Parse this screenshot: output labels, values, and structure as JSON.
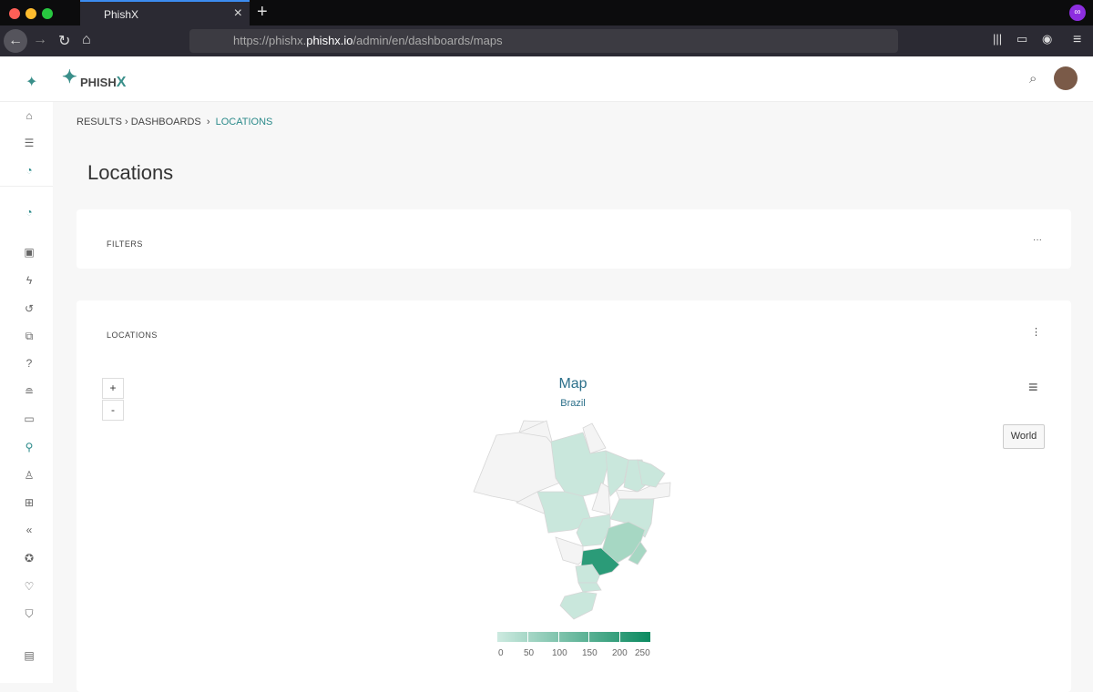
{
  "browser": {
    "tab_title": "PhishX",
    "url_prefix": "https://phishx.",
    "url_domain": "phishx.io",
    "url_path": "/admin/en/dashboards/maps"
  },
  "app": {
    "logo_text": "PHISH",
    "logo_x": "X"
  },
  "sidebar": {
    "icons": [
      "home-icon",
      "list-icon",
      "chart-pie-icon",
      "chart-pie-icon",
      "image-icon",
      "bolt-icon",
      "history-icon",
      "campaign-icon",
      "question-icon",
      "database-icon",
      "monitor-icon",
      "location-pin-icon",
      "user-icon",
      "presentation-icon",
      "rewind-icon",
      "award-icon",
      "heartbeat-icon",
      "shield-icon",
      "file-icon"
    ]
  },
  "breadcrumb": {
    "items": [
      "RESULTS",
      "DASHBOARDS"
    ],
    "current": "LOCATIONS"
  },
  "page": {
    "title": "Locations"
  },
  "filters": {
    "title": "FILTERS",
    "menu": "···"
  },
  "locations_card": {
    "title": "LOCATIONS",
    "menu": "⋮",
    "map": {
      "title": "Map",
      "subtitle": "Brazil",
      "zoom_in": "+",
      "zoom_out": "-",
      "world_button": "World",
      "menu": "≡",
      "legend_ticks": [
        "0",
        "50",
        "100",
        "150",
        "200",
        "250"
      ],
      "colors": {
        "none": "#f4f4f4",
        "low": "#c9e7dc",
        "mid": "#a6d7c3",
        "high": "#2b9b78"
      }
    }
  }
}
